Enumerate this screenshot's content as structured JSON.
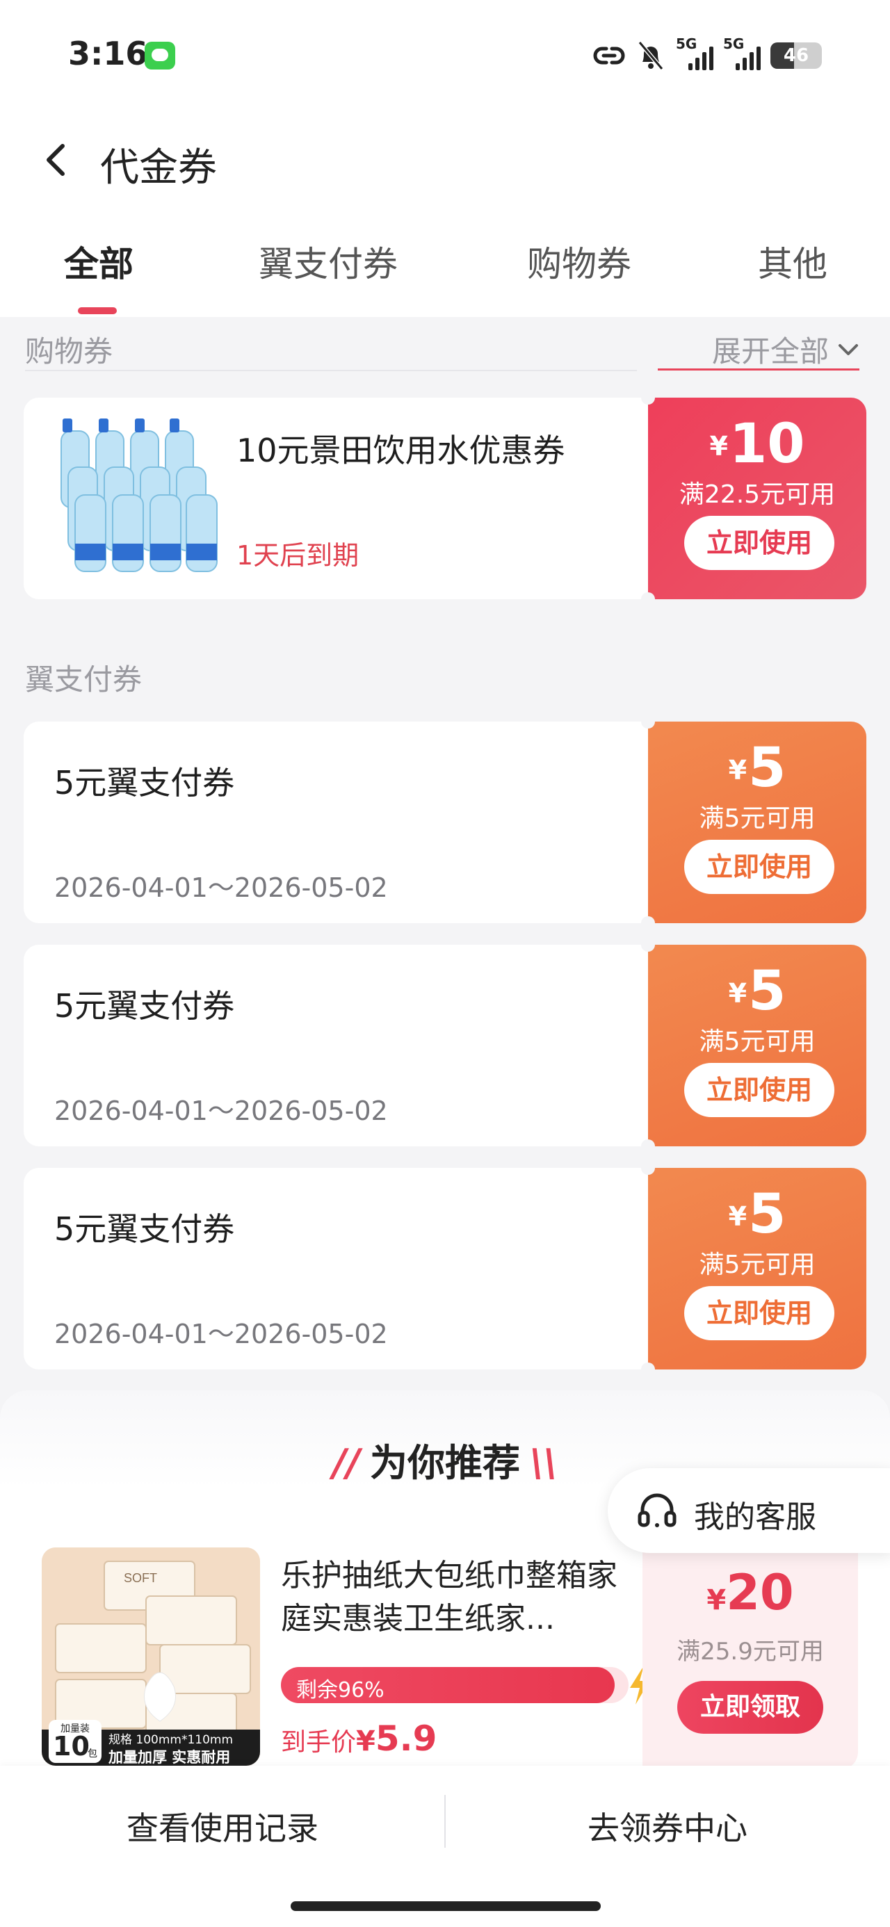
{
  "status_bar": {
    "time": "3:16",
    "signal1_label": "5G",
    "signal2_label": "5G",
    "battery": "46",
    "battery_level": 0.46
  },
  "header": {
    "title": "代金券"
  },
  "tabs": [
    {
      "label": "全部",
      "active": true
    },
    {
      "label": "翼支付券",
      "active": false
    },
    {
      "label": "购物券",
      "active": false
    },
    {
      "label": "其他",
      "active": false
    }
  ],
  "shopping_section": {
    "title": "购物券",
    "expand_label": "展开全部",
    "coupon": {
      "title": "10元景田饮用水优惠券",
      "expire": "1天后到期",
      "currency": "¥",
      "amount": "10",
      "condition": "满22.5元可用",
      "button": "立即使用"
    }
  },
  "pay_section": {
    "title": "翼支付券",
    "coupons": [
      {
        "title": "5元翼支付券",
        "date": "2026-04-01～2026-05-02",
        "currency": "¥",
        "amount": "5",
        "condition": "满5元可用",
        "button": "立即使用"
      },
      {
        "title": "5元翼支付券",
        "date": "2026-04-01～2026-05-02",
        "currency": "¥",
        "amount": "5",
        "condition": "满5元可用",
        "button": "立即使用"
      },
      {
        "title": "5元翼支付券",
        "date": "2026-04-01～2026-05-02",
        "currency": "¥",
        "amount": "5",
        "condition": "满5元可用",
        "button": "立即使用"
      }
    ]
  },
  "recommend": {
    "title": "为你推荐",
    "service_label": "我的客服",
    "product": {
      "title": "乐护抽纸大包纸巾整箱家庭实惠装卫生纸家...",
      "stock_text": "剩余96%",
      "stock_percent": 96,
      "price_label": "到手价",
      "price_currency": "¥",
      "price": "5.9",
      "coupon_currency": "¥",
      "coupon_amount": "20",
      "coupon_condition": "满25.9元可用",
      "button": "立即领取",
      "image_text": {
        "brand": "SOFT",
        "pack_label": "加量装",
        "pack_count": "10",
        "pack_unit": "包",
        "spec": "规格 100mm*110mm",
        "slogan": "加量加厚 实惠耐用"
      }
    }
  },
  "bottom_bar": {
    "records": "查看使用记录",
    "center": "去领券中心"
  },
  "colors": {
    "accent_red": "#e8445a",
    "coupon_orange": "#ef7a43",
    "background": "#f4f4f6"
  }
}
